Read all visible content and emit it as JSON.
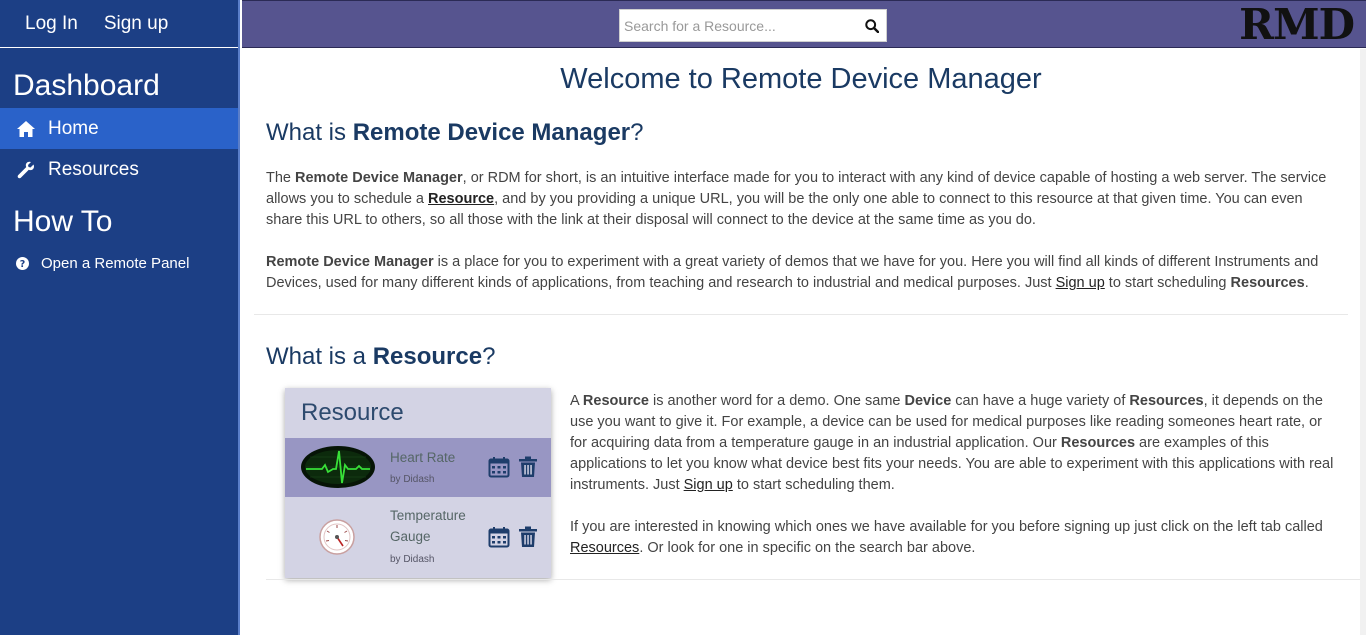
{
  "auth": {
    "login": "Log In",
    "signup": "Sign up"
  },
  "sidebar": {
    "dashboard_heading": "Dashboard",
    "items": [
      {
        "label": "Home",
        "icon": "home-icon",
        "active": true
      },
      {
        "label": "Resources",
        "icon": "wrench-icon",
        "active": false
      }
    ],
    "howto_heading": "How To",
    "howto_items": [
      {
        "label": "Open a Remote Panel",
        "icon": "question-circle-icon"
      }
    ]
  },
  "topbar": {
    "search_placeholder": "Search for a Resource...",
    "logo": "RMD"
  },
  "main": {
    "welcome": "Welcome to Remote Device Manager",
    "sec1": {
      "title_pre": "What is ",
      "title_bold": "Remote Device Manager",
      "title_post": "?",
      "p1": [
        {
          "t": "The "
        },
        {
          "t": "Remote Device Manager",
          "b": true
        },
        {
          "t": ", or RDM for short, is an intuitive interface made for you to interact with any kind of device capable of hosting a web server. The service allows you to schedule a "
        },
        {
          "t": "Resource",
          "b": true,
          "u": true
        },
        {
          "t": ", and by you providing a unique URL, you will be the only one able to connect to this resource at that given time. You can even share this URL to others, so all those with the link at their disposal will connect to the device at the same time as you do."
        }
      ],
      "p2": [
        {
          "t": "Remote Device Manager",
          "b": true
        },
        {
          "t": " is a place for you to experiment with a great variety of demos that we have for you. Here you will find all kinds of different Instruments and Devices, used for many different kinds of applications, from teaching and research to industrial and medical purposes. Just "
        },
        {
          "t": "Sign up",
          "u": true
        },
        {
          "t": " to start scheduling "
        },
        {
          "t": "Resources",
          "b": true
        },
        {
          "t": "."
        }
      ]
    },
    "sec2": {
      "title_pre": "What is a ",
      "title_bold": "Resource",
      "title_post": "?",
      "card": {
        "title": "Resource",
        "items": [
          {
            "name": "Heart Rate",
            "by": "by Didash",
            "thumb": "heart-rate-monitor-icon"
          },
          {
            "name": "Temperature Gauge",
            "by": "by Didash",
            "thumb": "temperature-gauge-icon"
          }
        ]
      },
      "p3": [
        {
          "t": "A "
        },
        {
          "t": "Resource",
          "b": true
        },
        {
          "t": " is another word for a demo. One same "
        },
        {
          "t": "Device",
          "b": true
        },
        {
          "t": " can have a huge variety of "
        },
        {
          "t": "Resources",
          "b": true
        },
        {
          "t": ", it depends on the use you want to give it. For example, a device can be used for medical purposes like reading someones heart rate, or for acquiring data from a temperature gauge in an industrial application. Our "
        },
        {
          "t": "Resources",
          "b": true
        },
        {
          "t": " are examples of this applications to let you know what device best fits your needs. You are able to experiment with this applications with real instruments. Just "
        },
        {
          "t": "Sign up",
          "u": true
        },
        {
          "t": " to start scheduling them."
        }
      ],
      "p4": [
        {
          "t": "If you are interested in knowing which ones we have available for you before signing up just click on the left tab called "
        },
        {
          "t": "Resources",
          "u": true
        },
        {
          "t": ". Or look for one in specific on the search bar above."
        }
      ]
    }
  }
}
